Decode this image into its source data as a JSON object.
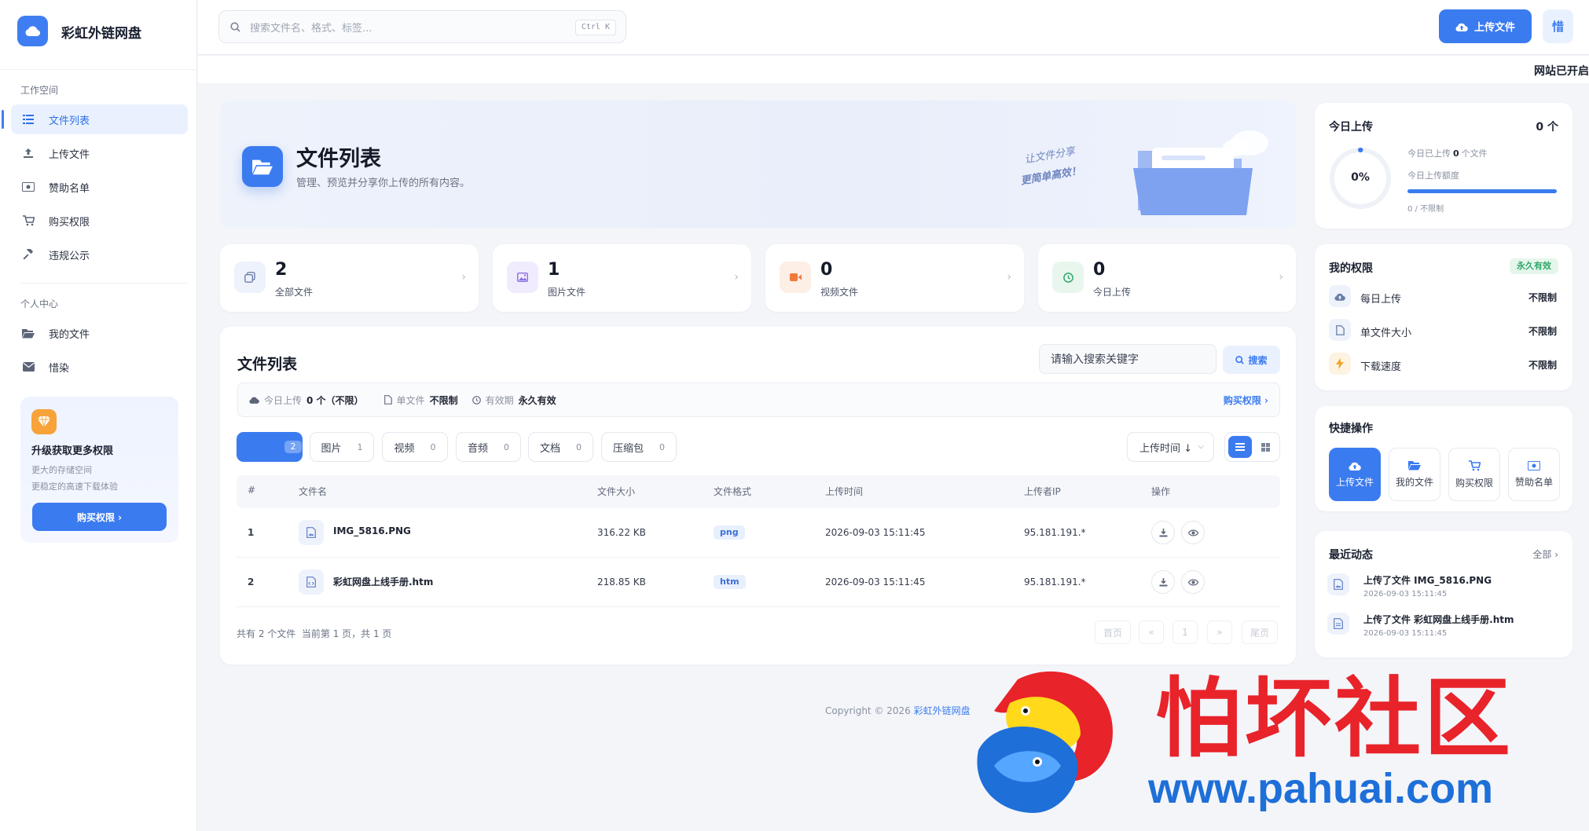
{
  "app": {
    "name": "彩虹外链网盘"
  },
  "sidebar": {
    "section_workspace": "工作空间",
    "workspace_items": [
      {
        "label": "文件列表",
        "icon": "list-icon",
        "active": true
      },
      {
        "label": "上传文件",
        "icon": "upload-icon"
      },
      {
        "label": "赞助名单",
        "icon": "money-icon"
      },
      {
        "label": "购买权限",
        "icon": "cart-icon"
      },
      {
        "label": "违规公示",
        "icon": "gavel-icon"
      }
    ],
    "section_personal": "个人中心",
    "personal_items": [
      {
        "label": "我的文件",
        "icon": "folder-open-icon"
      },
      {
        "label": "惜染",
        "icon": "mail-icon"
      }
    ],
    "upgrade": {
      "title": "升级获取更多权限",
      "line1": "更大的存储空间",
      "line2": "更稳定的高速下载体验",
      "button": "购买权限 ›"
    }
  },
  "topbar": {
    "search_placeholder": "搜索文件名、格式、标签...",
    "shortcut": "Ctrl K",
    "upload_button": "上传文件",
    "user_initial": "惜",
    "marquee": "网站已开启"
  },
  "hero": {
    "title": "文件列表",
    "subtitle": "管理、预览并分享你上传的所有内容。",
    "slogan_line1": "让文件分享",
    "slogan_line2": "更简单高效！"
  },
  "stats": [
    {
      "value": "2",
      "label": "全部文件",
      "icon": "copy-icon",
      "color": "#eef2fb",
      "fg": "#6b7fa8"
    },
    {
      "value": "1",
      "label": "图片文件",
      "icon": "image-icon",
      "color": "#f1ecfd",
      "fg": "#8b6fe0"
    },
    {
      "value": "0",
      "label": "视频文件",
      "icon": "video-icon",
      "color": "#fdeee6",
      "fg": "#f07a3a"
    },
    {
      "value": "0",
      "label": "今日上传",
      "icon": "clock-icon",
      "color": "#e8f6ee",
      "fg": "#2fa86a"
    }
  ],
  "file_panel": {
    "title": "文件列表",
    "search_placeholder": "请输入搜索关键字",
    "search_button": "搜索",
    "info": {
      "today_label": "今日上传",
      "today_value": "0 个（不限）",
      "single_label": "单文件",
      "single_value": "不限制",
      "valid_label": "有效期",
      "valid_value": "永久有效",
      "buy_link": "购买权限 ›"
    },
    "tabs": [
      {
        "label": "",
        "count": "2",
        "active": true
      },
      {
        "label": "图片",
        "count": "1"
      },
      {
        "label": "视频",
        "count": "0"
      },
      {
        "label": "音频",
        "count": "0"
      },
      {
        "label": "文档",
        "count": "0"
      },
      {
        "label": "压缩包",
        "count": "0"
      }
    ],
    "sort": "上传时间 ↓",
    "columns": [
      "#",
      "文件名",
      "文件大小",
      "文件格式",
      "上传时间",
      "上传者IP",
      "操作"
    ],
    "rows": [
      {
        "index": "1",
        "name": "IMG_5816.PNG",
        "size": "316.22 KB",
        "format": "png",
        "time": "2026-09-03 15:11:45",
        "ip": "95.181.191.*"
      },
      {
        "index": "2",
        "name": "彩虹网盘上线手册.htm",
        "size": "218.85 KB",
        "format": "htm",
        "time": "2026-09-03 15:11:45",
        "ip": "95.181.191.*"
      }
    ],
    "footer_summary": "共有 2 个文件  当前第 1 页，共 1 页",
    "pager": [
      "首页",
      "«",
      "1",
      "»",
      "尾页"
    ]
  },
  "footer": {
    "copyright": "Copyright © 2026 ",
    "brand": "彩虹外链网盘"
  },
  "today_upload": {
    "title": "今日上传",
    "count": "0 个",
    "percent": "0%",
    "percent_value": 0,
    "line1_prefix": "今日已上传",
    "line1_value": "0",
    "line1_suffix": "个文件",
    "line2": "今日上传额度",
    "quota": "0 / 不限制"
  },
  "permissions": {
    "title": "我的权限",
    "badge": "永久有效",
    "items": [
      {
        "label": "每日上传",
        "value": "不限制",
        "icon": "cloud-upload-icon",
        "bg": "#eef2fb",
        "fg": "#6b7fa8"
      },
      {
        "label": "单文件大小",
        "value": "不限制",
        "icon": "file-icon",
        "bg": "#eef2fb",
        "fg": "#6b7fa8"
      },
      {
        "label": "下载速度",
        "value": "不限制",
        "icon": "bolt-icon",
        "bg": "#fdf3e2",
        "fg": "#f0a429"
      }
    ]
  },
  "quick_actions": {
    "title": "快捷操作",
    "items": [
      {
        "label": "上传文件",
        "icon": "cloud-upload-icon",
        "active": true
      },
      {
        "label": "我的文件",
        "icon": "folder-open-icon"
      },
      {
        "label": "购买权限",
        "icon": "cart-icon"
      },
      {
        "label": "赞助名单",
        "icon": "money-icon"
      }
    ]
  },
  "recent": {
    "title": "最近动态",
    "all": "全部 ›",
    "items": [
      {
        "text": "上传了文件 IMG_5816.PNG",
        "time": "2026-09-03 15:11:45",
        "icon": "image-icon"
      },
      {
        "text": "上传了文件 彩虹网盘上线手册.htm",
        "time": "2026-09-03 15:11:45",
        "icon": "file-icon"
      }
    ]
  },
  "watermark": {
    "text": "怕坏社区",
    "url": "www.pahuai.com"
  }
}
